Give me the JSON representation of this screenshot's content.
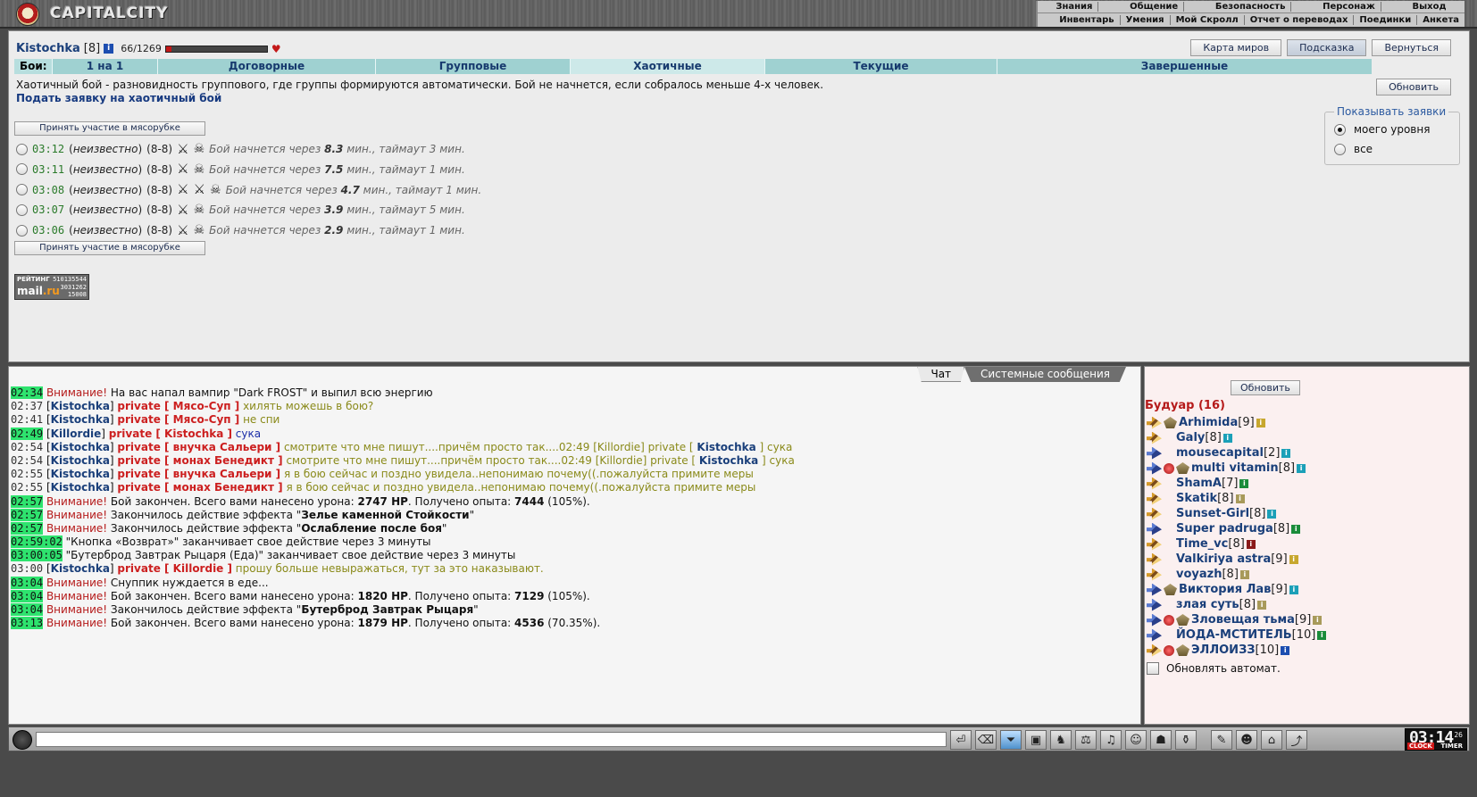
{
  "header": {
    "logo_text": "CAPITALCITY",
    "menu_main": [
      "Знания",
      "Общение",
      "Безопасность",
      "Персонаж",
      "Выход"
    ],
    "menu_sub": [
      "Инвентарь",
      "Умения",
      "Мой Скролл",
      "Отчет о переводах",
      "Поединки",
      "Анкета"
    ]
  },
  "player": {
    "name": "Kistochka",
    "level": "[8]",
    "info_icon": "i",
    "hp": "66/1269",
    "hp_fraction": 0.052
  },
  "top_buttons": [
    "Карта миров",
    "Подсказка",
    "Вернуться"
  ],
  "fight_tabs": {
    "label": "Бои:",
    "tabs": [
      "1 на 1",
      "Договорные",
      "Групповые",
      "Хаотичные",
      "Текущие",
      "Завершенные"
    ],
    "active": "Хаотичные"
  },
  "description": "Хаотичный бой - разновидность группового, где группы формируются автоматически. Бой не начнется, если собралось меньше 4-х человек.",
  "apply_link": "Подать заявку на хаотичный бой",
  "refresh_label": "Обновить",
  "join_button": "Принять участие в мясорубке",
  "requests": [
    {
      "time": "03:12",
      "who": "неизвестно",
      "teams": "(8-8)",
      "icons": [
        "swords-icon",
        "skull-icon"
      ],
      "status_pre": "Бой начнется через ",
      "minutes": "8.3",
      "status_post": " мин., таймаут 3 мин."
    },
    {
      "time": "03:11",
      "who": "неизвестно",
      "teams": "(8-8)",
      "icons": [
        "swords-icon",
        "skull-icon"
      ],
      "status_pre": "Бой начнется через ",
      "minutes": "7.5",
      "status_post": " мин., таймаут 1 мин."
    },
    {
      "time": "03:08",
      "who": "неизвестно",
      "teams": "(8-8)",
      "icons": [
        "swords-icon",
        "crossed-swords-icon",
        "skull-icon"
      ],
      "status_pre": "Бой начнется через ",
      "minutes": "4.7",
      "status_post": " мин., таймаут 1 мин."
    },
    {
      "time": "03:07",
      "who": "неизвестно",
      "teams": "(8-8)",
      "icons": [
        "swords-icon",
        "skull-icon"
      ],
      "status_pre": "Бой начнется через ",
      "minutes": "3.9",
      "status_post": " мин., таймаут 5 мин."
    },
    {
      "time": "03:06",
      "who": "неизвестно",
      "teams": "(8-8)",
      "icons": [
        "swords-icon",
        "skull-icon"
      ],
      "status_pre": "Бой начнется через ",
      "minutes": "2.9",
      "status_post": " мин., таймаут 1 мин."
    }
  ],
  "show_requests": {
    "title": "Показывать заявки",
    "options": [
      "моего уровня",
      "все"
    ],
    "selected": "моего уровня"
  },
  "rating_badge": {
    "line1": "РЕЙТИНГ",
    "line2a": "mail",
    "line2b": ".ru",
    "n1": "510135544",
    "n2": "3031262",
    "n3": "15008"
  },
  "chat_tabs": [
    "Чат",
    "Системные сообщения"
  ],
  "chat": [
    {
      "ts": "02:34",
      "hl": true,
      "parts": [
        [
          "att",
          "Внимание!"
        ],
        [
          "txt",
          " На вас напал вампир \"Dark FROST\" и выпил всю энергию"
        ]
      ]
    },
    {
      "ts": "02:37",
      "hl": false,
      "parts": [
        [
          "txt",
          "["
        ],
        [
          "nm",
          "Kistochka"
        ],
        [
          "txt",
          "] "
        ],
        [
          "pv",
          "private [ Мясо-Суп ]"
        ],
        [
          "ol",
          " хилять можешь в бою?"
        ]
      ]
    },
    {
      "ts": "02:41",
      "hl": false,
      "parts": [
        [
          "txt",
          "["
        ],
        [
          "nm",
          "Kistochka"
        ],
        [
          "txt",
          "] "
        ],
        [
          "pv",
          "private [ Мясо-Суп ]"
        ],
        [
          "ol",
          " не спи"
        ]
      ]
    },
    {
      "ts": "02:49",
      "hl": true,
      "parts": [
        [
          "txt",
          "["
        ],
        [
          "nm",
          "Killordie"
        ],
        [
          "txt",
          "] "
        ],
        [
          "pv",
          "private [ Kistochka ]"
        ],
        [
          "bl",
          " сука"
        ]
      ]
    },
    {
      "ts": "02:54",
      "hl": false,
      "parts": [
        [
          "txt",
          "["
        ],
        [
          "nm",
          "Kistochka"
        ],
        [
          "txt",
          "] "
        ],
        [
          "pv",
          "private [ внучка Сальери ]"
        ],
        [
          "ol",
          " смотрите что мне пишут....причём просто так....02:49 [Killordie] private [ "
        ],
        [
          "nm",
          "Kistochka"
        ],
        [
          "ol",
          " ] сука"
        ]
      ]
    },
    {
      "ts": "02:54",
      "hl": false,
      "parts": [
        [
          "txt",
          "["
        ],
        [
          "nm",
          "Kistochka"
        ],
        [
          "txt",
          "] "
        ],
        [
          "pv",
          "private [ монах Бенедикт ]"
        ],
        [
          "ol",
          " смотрите что мне пишут....причём просто так....02:49 [Killordie] private [ "
        ],
        [
          "nm",
          "Kistochka"
        ],
        [
          "ol",
          " ] сука"
        ]
      ]
    },
    {
      "ts": "02:55",
      "hl": false,
      "parts": [
        [
          "txt",
          "["
        ],
        [
          "nm",
          "Kistochka"
        ],
        [
          "txt",
          "] "
        ],
        [
          "pv",
          "private [ внучка Сальери ]"
        ],
        [
          "ol",
          " я в бою сейчас и поздно увидела..непонимаю почему((.пожалуйста примите меры"
        ]
      ]
    },
    {
      "ts": "02:55",
      "hl": false,
      "parts": [
        [
          "txt",
          "["
        ],
        [
          "nm",
          "Kistochka"
        ],
        [
          "txt",
          "] "
        ],
        [
          "pv",
          "private [ монах Бенедикт ]"
        ],
        [
          "ol",
          " я в бою сейчас и поздно увидела..непонимаю почему((.пожалуйста примите меры"
        ]
      ]
    },
    {
      "ts": "02:57",
      "hl": true,
      "parts": [
        [
          "att",
          "Внимание!"
        ],
        [
          "txt",
          " Бой закончен. Всего вами нанесено урона: "
        ],
        [
          "mb",
          "2747 HP"
        ],
        [
          "txt",
          ". Получено опыта: "
        ],
        [
          "mb",
          "7444"
        ],
        [
          "txt",
          " (105%)."
        ]
      ]
    },
    {
      "ts": "02:57",
      "hl": true,
      "parts": [
        [
          "att",
          "Внимание!"
        ],
        [
          "txt",
          " Закончилось действие эффекта \""
        ],
        [
          "mb",
          "Зелье каменной Стойкости"
        ],
        [
          "txt",
          "\""
        ]
      ]
    },
    {
      "ts": "02:57",
      "hl": true,
      "parts": [
        [
          "att",
          "Внимание!"
        ],
        [
          "txt",
          " Закончилось действие эффекта \""
        ],
        [
          "mb",
          "Ослабление после боя"
        ],
        [
          "txt",
          "\""
        ]
      ]
    },
    {
      "ts": "02:59:02",
      "hl": true,
      "parts": [
        [
          "txt",
          " \"Кнопка «Возврат»\" заканчивает свое действие через 3 минуты"
        ]
      ]
    },
    {
      "ts": "03:00:05",
      "hl": true,
      "parts": [
        [
          "txt",
          " \"Бутерброд Завтрак Рыцаря (Еда)\" заканчивает свое действие через 3 минуты"
        ]
      ]
    },
    {
      "ts": "03:00",
      "hl": false,
      "parts": [
        [
          "txt",
          "["
        ],
        [
          "nm",
          "Kistochka"
        ],
        [
          "txt",
          "] "
        ],
        [
          "pv",
          "private [ Killordie ]"
        ],
        [
          "ol",
          " прошу больше невыражаться, тут за это наказывают."
        ]
      ]
    },
    {
      "ts": "03:04",
      "hl": true,
      "parts": [
        [
          "att",
          "Внимание!"
        ],
        [
          "txt",
          " Снуппик нуждается в еде..."
        ]
      ]
    },
    {
      "ts": "03:04",
      "hl": true,
      "parts": [
        [
          "att",
          "Внимание!"
        ],
        [
          "txt",
          " Бой закончен. Всего вами нанесено урона: "
        ],
        [
          "mb",
          "1820 HP"
        ],
        [
          "txt",
          ". Получено опыта: "
        ],
        [
          "mb",
          "7129"
        ],
        [
          "txt",
          " (105%)."
        ]
      ]
    },
    {
      "ts": "03:04",
      "hl": true,
      "parts": [
        [
          "att",
          "Внимание!"
        ],
        [
          "txt",
          " Закончилось действие эффекта \""
        ],
        [
          "mb",
          "Бутерброд Завтрак Рыцаря"
        ],
        [
          "txt",
          "\""
        ]
      ]
    },
    {
      "ts": "03:13",
      "hl": true,
      "parts": [
        [
          "att",
          "Внимание!"
        ],
        [
          "txt",
          " Бой закончен. Всего вами нанесено урона: "
        ],
        [
          "mb",
          "1879 HP"
        ],
        [
          "txt",
          ". Получено опыта: "
        ],
        [
          "mb",
          "4536"
        ],
        [
          "txt",
          " (70.35%)."
        ]
      ]
    }
  ],
  "room": {
    "refresh_label": "Обновить",
    "title": "Будуар (16)",
    "users": [
      {
        "icons": [
          "g1",
          "cl"
        ],
        "name": "Arhimida",
        "level": "[9]",
        "inf": "y"
      },
      {
        "icons": [
          "g1"
        ],
        "name": "Galy",
        "level": "[8]",
        "inf": "c"
      },
      {
        "icons": [
          "g2"
        ],
        "name": "mousecapital",
        "level": "[2]",
        "inf": "c"
      },
      {
        "icons": [
          "g2",
          "al",
          "cl"
        ],
        "name": "multi vitamin",
        "level": "[8]",
        "inf": "c"
      },
      {
        "icons": [
          "g1"
        ],
        "name": "ShamA",
        "level": "[7]",
        "inf": "gr"
      },
      {
        "icons": [
          "g1"
        ],
        "name": "Skatik",
        "level": "[8]",
        "inf": "o"
      },
      {
        "icons": [
          "g1"
        ],
        "name": "Sunset-Girl",
        "level": "[8]",
        "inf": "c"
      },
      {
        "icons": [
          "g2"
        ],
        "name": "Super padruga",
        "level": "[8]",
        "inf": "gr"
      },
      {
        "icons": [
          "g1"
        ],
        "name": "Time_vc",
        "level": "[8]",
        "inf": "dr"
      },
      {
        "icons": [
          "g1"
        ],
        "name": "Valkiriya astra",
        "level": "[9]",
        "inf": "y"
      },
      {
        "icons": [
          "g1"
        ],
        "name": "voyazh",
        "level": "[8]",
        "inf": "o"
      },
      {
        "icons": [
          "g2",
          "cl"
        ],
        "name": "Виктория Лав",
        "level": "[9]",
        "inf": "c"
      },
      {
        "icons": [
          "g2"
        ],
        "name": "злая суть",
        "level": "[8]",
        "inf": "o"
      },
      {
        "icons": [
          "g2",
          "al",
          "cl"
        ],
        "name": "Зловещая тьма",
        "level": "[9]",
        "inf": "o"
      },
      {
        "icons": [
          "g2"
        ],
        "name": "ЙОДА-МСТИТЕЛЬ",
        "level": "[10]",
        "inf": "gr"
      },
      {
        "icons": [
          "g1",
          "al",
          "cl"
        ],
        "name": "ЭЛЛОИЗЗ",
        "level": "[10]",
        "inf": "b"
      }
    ],
    "auto_refresh": "Обновлять автомат."
  },
  "bottom": {
    "tool_icons": [
      "enter-icon",
      "eraser-icon",
      "filter-icon",
      "save-icon",
      "fight-icon",
      "trade-icon",
      "music-icon",
      "smile-icon",
      "mask-icon",
      "bag-icon",
      "scroll-icon",
      "face-icon",
      "lock-icon",
      "exit-icon"
    ],
    "clock": "03:14",
    "clock_seconds": "26",
    "clock_label": "CLOCK",
    "timer_label": "TIMER"
  }
}
